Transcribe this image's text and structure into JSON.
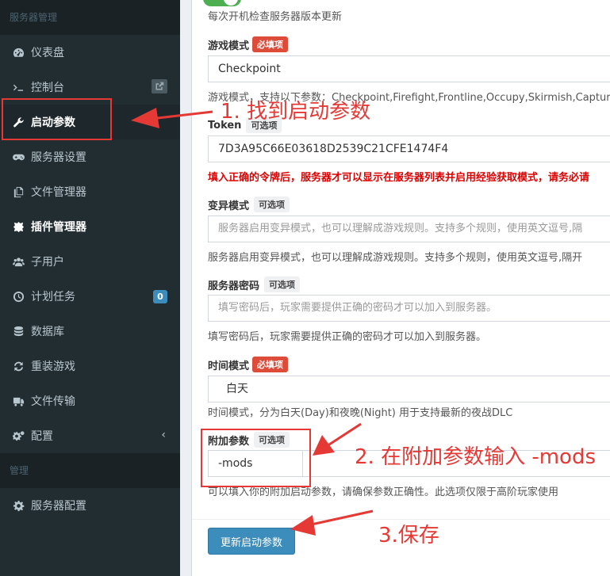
{
  "sidebar": {
    "header_server": "服务器管理",
    "header_manage": "管理",
    "items": [
      {
        "label": "仪表盘",
        "icon": "dashboard-icon"
      },
      {
        "label": "控制台",
        "icon": "terminal-icon"
      },
      {
        "label": "启动参数",
        "icon": "wrench-icon"
      },
      {
        "label": "服务器设置",
        "icon": "gamepad-icon"
      },
      {
        "label": "文件管理器",
        "icon": "files-icon"
      },
      {
        "label": "插件管理器",
        "icon": "puzzle-icon"
      },
      {
        "label": "子用户",
        "icon": "users-icon"
      },
      {
        "label": "计划任务",
        "icon": "clock-icon"
      },
      {
        "label": "数据库",
        "icon": "database-icon"
      },
      {
        "label": "重装游戏",
        "icon": "refresh-icon"
      },
      {
        "label": "文件传输",
        "icon": "truck-icon"
      },
      {
        "label": "配置",
        "icon": "cogs-icon"
      }
    ],
    "schedule_badge": "0",
    "manage_items": [
      {
        "label": "服务器配置",
        "icon": "gear-icon"
      }
    ]
  },
  "form": {
    "auto_update_hint": "每次开机检查服务器版本更新",
    "required_tag": "必填项",
    "optional_tag": "可选项",
    "game_mode": {
      "label": "游戏模式",
      "value": "Checkpoint",
      "hint": "游戏模式，支持以下参数：Checkpoint,Firefight,Frontline,Occupy,Skirmish,Captur"
    },
    "token": {
      "label": "Token",
      "value": "7D3A95C66E03618D2539C21CFE1474F4",
      "warning": "填入正确的令牌后，服务器才可以显示在服务器列表并启用经验获取模式，请务必请"
    },
    "mutator": {
      "label": "变异模式",
      "placeholder": "服务器启用变异模式，也可以理解成游戏规则。支持多个规则，使用英文逗号,隔",
      "hint": "服务器启用变异模式，也可以理解成游戏规则。支持多个规则，使用英文逗号,隔开"
    },
    "password": {
      "label": "服务器密码",
      "placeholder": "填写密码后，玩家需要提供正确的密码才可以加入到服务器。",
      "hint": "填写密码后，玩家需要提供正确的密码才可以加入到服务器。"
    },
    "time_mode": {
      "label": "时间模式",
      "value": "白天",
      "hint": "时间模式，分为白天(Day)和夜晚(Night) 用于支持最新的夜战DLC"
    },
    "extra_args": {
      "label": "附加参数",
      "value": "-mods",
      "hint": "可以填入你的附加启动参数，请确保参数正确性。此选项仅限于高阶玩家使用"
    },
    "submit_label": "更新启动参数"
  },
  "annotations": {
    "step1": "1. 找到启动参数",
    "step2": "2. 在附加参数输入 -mods",
    "step3": "3.保存",
    "color": "#e53935"
  },
  "colors": {
    "sidebar_bg": "#222d32",
    "primary": "#3c8dbc",
    "danger": "#dd4b39",
    "toggle_on": "#4caf50"
  }
}
